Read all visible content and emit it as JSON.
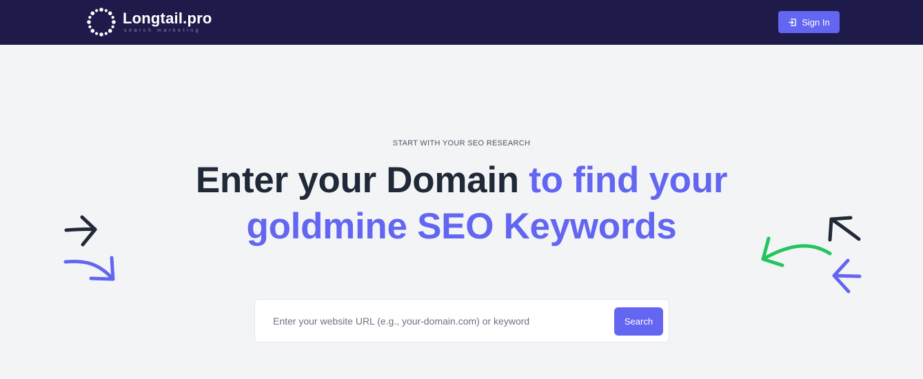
{
  "header": {
    "logo_name": "Longtail.pro",
    "logo_tagline": "search marketing",
    "signin_label": "Sign In"
  },
  "hero": {
    "eyebrow": "START WITH YOUR SEO RESEARCH",
    "headline_dark": "Enter your Domain",
    "headline_accent_1": "to find your",
    "headline_accent_2": "goldmine SEO Keywords"
  },
  "search": {
    "placeholder": "Enter your website URL (e.g., your-domain.com) or keyword",
    "value": "",
    "button_label": "Search"
  },
  "colors": {
    "header_bg": "#1e1b4b",
    "accent": "#6366f1",
    "dark_text": "#1f2937",
    "page_bg": "#f3f4f6",
    "green_arrow": "#22c55e"
  },
  "icons": {
    "logo": "dotted-circle-logo-icon",
    "signin": "sign-in-icon",
    "decorations": [
      "dark-arrow-right-icon",
      "purple-curved-arrow-icon",
      "green-curved-arrow-icon",
      "dark-arrow-up-left-icon",
      "purple-chevron-left-icon"
    ]
  }
}
